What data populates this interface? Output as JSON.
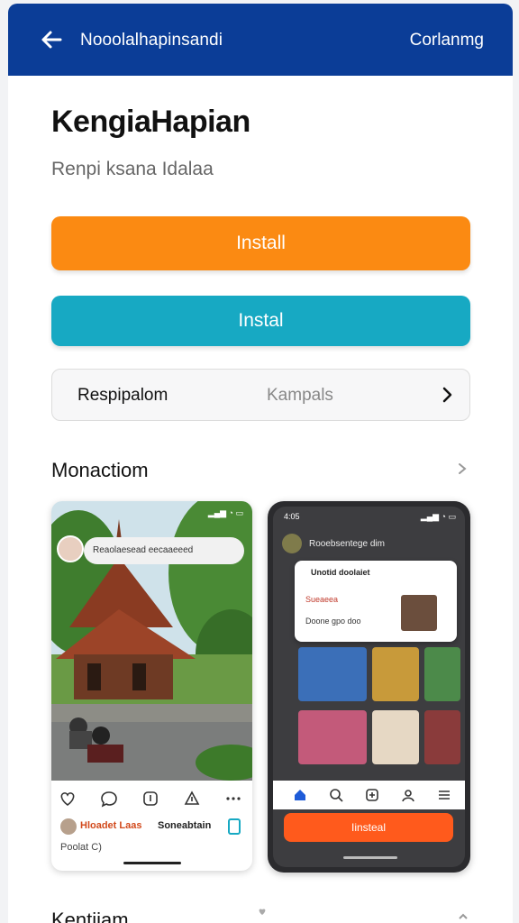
{
  "appbar": {
    "title": "Nooolalhapinsandi",
    "action": "Corlanmg",
    "color": "#0b3d97"
  },
  "heading": "KengiaHapian",
  "subheading": "Renpi ksana Idalaa",
  "buttons": {
    "primary_label": "Install",
    "primary_color": "#fb8a12",
    "secondary_label": "Instal",
    "secondary_color": "#17a9c3"
  },
  "selector": {
    "label": "Respipalom",
    "value": "Kampals"
  },
  "section": {
    "title": "Monactiom"
  },
  "post": {
    "pill_text": "Reaolaesead eecaaeeed",
    "user_name": "Hloadet Laas",
    "user_handle": "Soneabtain",
    "meta": "Poolat C)"
  },
  "phone": {
    "time": "4:05",
    "header_title": "Rooebsentege dim",
    "notif_title": "Unotid doolaiet",
    "notif_line2": "Sueaeea",
    "notif_line3": "Doone gpo doo",
    "cta_label": "Iinsteal",
    "cta_color": "#ff5a1c"
  },
  "next_section": {
    "title": "Kentiiam"
  }
}
